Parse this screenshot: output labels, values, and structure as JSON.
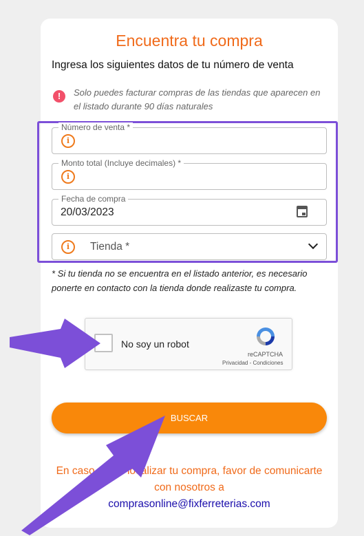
{
  "header": {
    "title": "Encuentra tu compra",
    "subtitle": "Ingresa los siguientes datos de tu número de venta"
  },
  "notice": {
    "text": "Solo puedes facturar compras de las tiendas que aparecen en el listado durante 90 días naturales"
  },
  "form": {
    "numero_venta_label": "Número de venta *",
    "monto_label": "Monto total (Incluye decimales) *",
    "fecha_label": "Fecha de compra",
    "fecha_value": "20/03/2023",
    "tienda_placeholder": "Tienda *"
  },
  "disclaimer": "* Si tu tienda no se encuentra en el listado anterior, es necesario ponerte en contacto con la tienda donde realizaste tu compra.",
  "recaptcha": {
    "label": "No soy un robot",
    "brand": "reCAPTCHA",
    "links": "Privacidad - Condiciones"
  },
  "buscar_label": "BUSCAR",
  "footer": {
    "text": "En caso de no localizar tu compra, favor de comunicarte con nosotros a",
    "email": "comprasonline@fixferreterias.com"
  },
  "colors": {
    "accent_orange": "#f06a1a",
    "button_orange": "#f9880a",
    "highlight_purple": "#7c4fd8",
    "notice_red": "#f2506a"
  }
}
